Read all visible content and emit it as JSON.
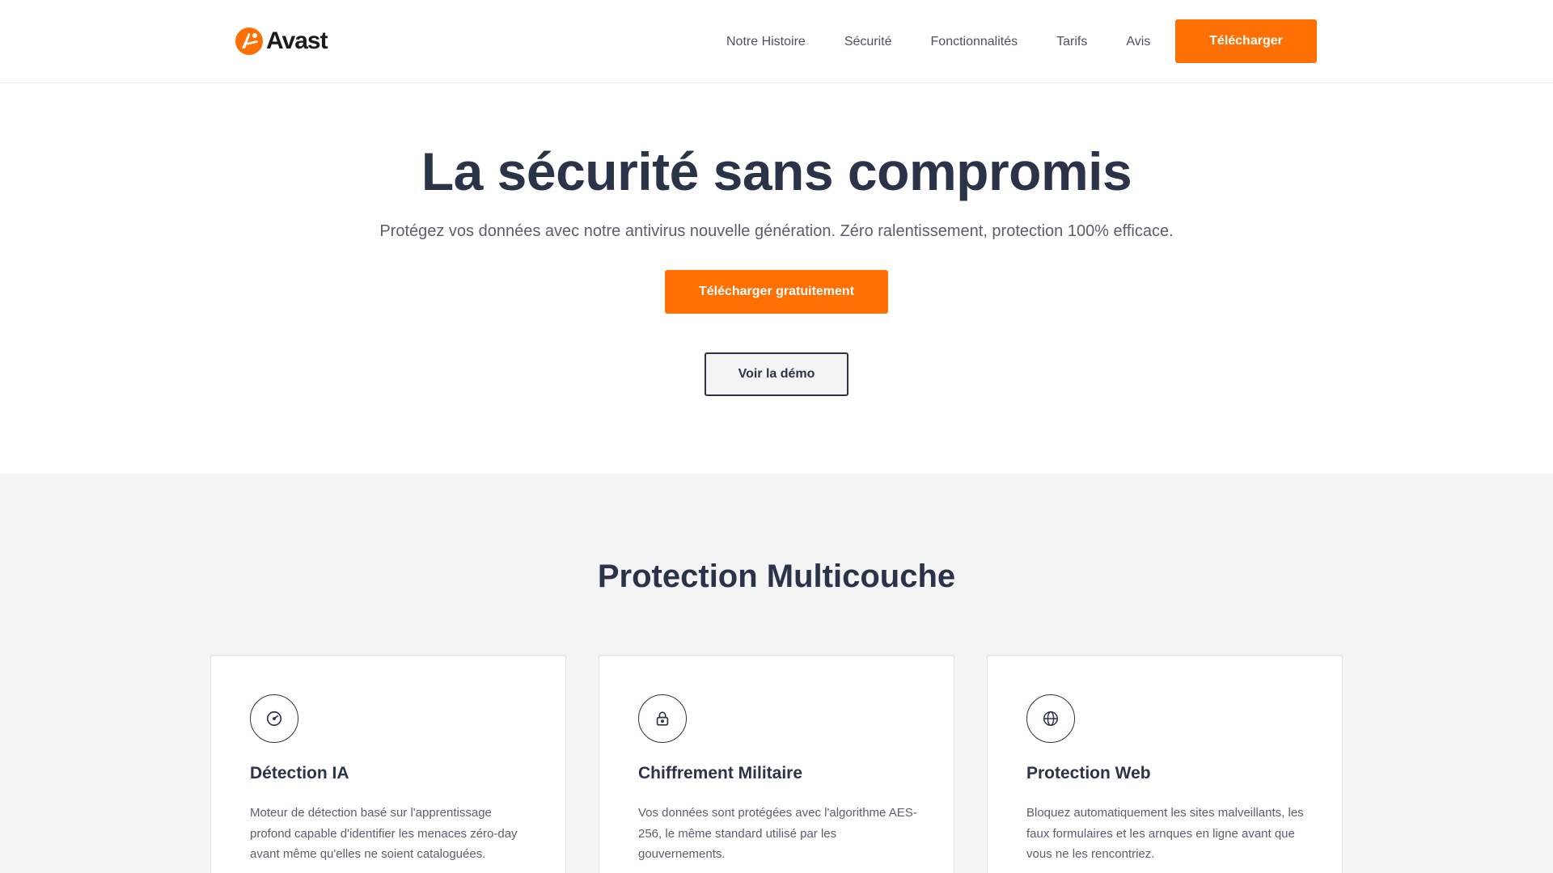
{
  "header": {
    "logo_text": "Avast",
    "nav": [
      "Notre Histoire",
      "Sécurité",
      "Fonctionnalités",
      "Tarifs",
      "Avis"
    ],
    "cta_label": "Télécharger"
  },
  "hero": {
    "title": "La sécurité sans compromis",
    "subtitle": "Protégez vos données avec notre antivirus nouvelle génération. Zéro ralentissement, protection 100% efficace.",
    "primary_label": "Télécharger gratuitement",
    "secondary_label": "Voir la démo"
  },
  "features": {
    "title": "Protection Multicouche",
    "cards": [
      {
        "icon": "gauge-icon",
        "title": "Détection IA",
        "description": "Moteur de détection basé sur l'apprentissage profond capable d'identifier les menaces zéro-day avant même qu'elles ne soient cataloguées."
      },
      {
        "icon": "lock-icon",
        "title": "Chiffrement Militaire",
        "description": "Vos données sont protégées avec l'algorithme AES-256, le même standard utilisé par les gouvernements."
      },
      {
        "icon": "globe-icon",
        "title": "Protection Web",
        "description": "Bloquez automatiquement les sites malveillants, les faux formulaires et les arnques en ligne avant que vous ne les rencontriez."
      }
    ]
  },
  "colors": {
    "accent": "#ff7004",
    "heading": "#2b3349",
    "body_text": "#5a5f6b",
    "section_bg": "#f4f4f4"
  }
}
